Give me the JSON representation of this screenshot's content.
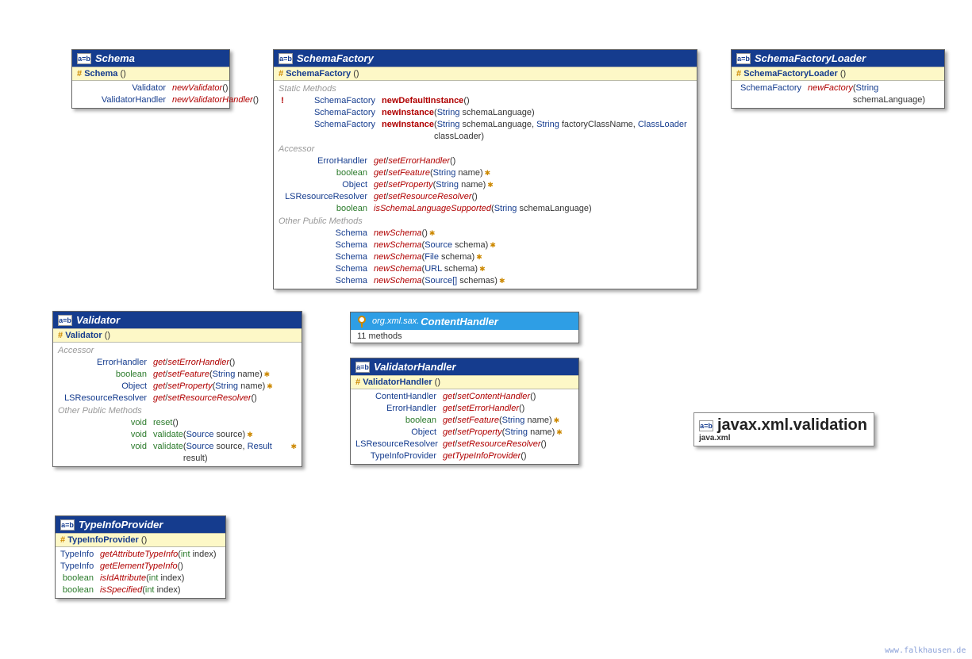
{
  "icons": {
    "ab_label": "a=b"
  },
  "package": {
    "name": "javax.xml.validation",
    "module": "java.xml"
  },
  "footer": "www.falkhausen.de",
  "classes": {
    "schema": {
      "title": "Schema",
      "constructor": "Schema",
      "methods": [
        {
          "ret": "Validator",
          "name": "newValidator",
          "params": "()"
        },
        {
          "ret": "ValidatorHandler",
          "name": "newValidatorHandler",
          "params": "()"
        }
      ]
    },
    "schemaFactory": {
      "title": "SchemaFactory",
      "constructor": "SchemaFactory",
      "sections": {
        "static": {
          "label": "Static Methods",
          "methods": [
            {
              "bang": true,
              "ret": "SchemaFactory",
              "name": "newDefaultInstance",
              "params": "()"
            },
            {
              "ret": "SchemaFactory",
              "name": "newInstance",
              "params_raw": [
                {
                  "t": "("
                },
                {
                  "t": "String ",
                  "c": "ptype"
                },
                {
                  "t": "schemaLanguage)"
                }
              ]
            },
            {
              "ret": "SchemaFactory",
              "name": "newInstance",
              "params_raw": [
                {
                  "t": "("
                },
                {
                  "t": "String ",
                  "c": "ptype"
                },
                {
                  "t": "schemaLanguage, "
                },
                {
                  "t": "String ",
                  "c": "ptype"
                },
                {
                  "t": "factoryClassName, "
                },
                {
                  "t": "ClassLoader ",
                  "c": "ptype"
                },
                {
                  "t": "classLoader)"
                }
              ]
            }
          ]
        },
        "accessor": {
          "label": "Accessor",
          "methods": [
            {
              "ret": "ErrorHandler",
              "getset": "ErrorHandler",
              "params": "()"
            },
            {
              "ret": "boolean",
              "prim": true,
              "getset": "Feature",
              "params_raw": [
                {
                  "t": "("
                },
                {
                  "t": "String ",
                  "c": "ptype"
                },
                {
                  "t": "name)"
                }
              ],
              "exc": true
            },
            {
              "ret": "Object",
              "getset": "Property",
              "params_raw": [
                {
                  "t": "("
                },
                {
                  "t": "String ",
                  "c": "ptype"
                },
                {
                  "t": "name)"
                }
              ],
              "exc": true
            },
            {
              "ret": "LSResourceResolver",
              "getset": "ResourceResolver",
              "params": "()"
            },
            {
              "ret": "boolean",
              "prim": true,
              "name": "isSchemaLanguageSupported",
              "params_raw": [
                {
                  "t": "("
                },
                {
                  "t": "String ",
                  "c": "ptype"
                },
                {
                  "t": "schemaLanguage)"
                }
              ]
            }
          ]
        },
        "other": {
          "label": "Other Public Methods",
          "methods": [
            {
              "ret": "Schema",
              "name": "newSchema",
              "params": "()",
              "exc": true
            },
            {
              "ret": "Schema",
              "name": "newSchema",
              "params_raw": [
                {
                  "t": "("
                },
                {
                  "t": "Source ",
                  "c": "ptype"
                },
                {
                  "t": "schema)"
                }
              ],
              "exc": true
            },
            {
              "ret": "Schema",
              "name": "newSchema",
              "params_raw": [
                {
                  "t": "("
                },
                {
                  "t": "File ",
                  "c": "ptype"
                },
                {
                  "t": "schema)"
                }
              ],
              "exc": true
            },
            {
              "ret": "Schema",
              "name": "newSchema",
              "params_raw": [
                {
                  "t": "("
                },
                {
                  "t": "URL ",
                  "c": "ptype"
                },
                {
                  "t": "schema)"
                }
              ],
              "exc": true
            },
            {
              "ret": "Schema",
              "name": "newSchema",
              "params_raw": [
                {
                  "t": "("
                },
                {
                  "t": "Source[] ",
                  "c": "ptype"
                },
                {
                  "t": "schemas)"
                }
              ],
              "exc": true
            }
          ]
        }
      }
    },
    "schemaFactoryLoader": {
      "title": "SchemaFactoryLoader",
      "constructor": "SchemaFactoryLoader",
      "methods": [
        {
          "ret": "SchemaFactory",
          "name": "newFactory",
          "params_raw": [
            {
              "t": "("
            },
            {
              "t": "String ",
              "c": "ptype"
            },
            {
              "t": "schemaLanguage)"
            }
          ]
        }
      ]
    },
    "validator": {
      "title": "Validator",
      "constructor": "Validator",
      "sections": {
        "accessor": {
          "label": "Accessor",
          "methods": [
            {
              "ret": "ErrorHandler",
              "getset": "ErrorHandler",
              "params": "()"
            },
            {
              "ret": "boolean",
              "prim": true,
              "getset": "Feature",
              "params_raw": [
                {
                  "t": "("
                },
                {
                  "t": "String ",
                  "c": "ptype"
                },
                {
                  "t": "name)"
                }
              ],
              "exc": true
            },
            {
              "ret": "Object",
              "getset": "Property",
              "params_raw": [
                {
                  "t": "("
                },
                {
                  "t": "String ",
                  "c": "ptype"
                },
                {
                  "t": "name)"
                }
              ],
              "exc": true
            },
            {
              "ret": "LSResourceResolver",
              "getset": "ResourceResolver",
              "params": "()"
            }
          ]
        },
        "other": {
          "label": "Other Public Methods",
          "methods": [
            {
              "ret": "void",
              "prim": true,
              "name_plain": "reset",
              "params": "()"
            },
            {
              "ret": "void",
              "prim": true,
              "name_plain": "validate",
              "params_raw": [
                {
                  "t": "("
                },
                {
                  "t": "Source ",
                  "c": "ptype"
                },
                {
                  "t": "source)"
                }
              ],
              "exc": true
            },
            {
              "ret": "void",
              "prim": true,
              "name_plain": "validate",
              "params_raw": [
                {
                  "t": "("
                },
                {
                  "t": "Source ",
                  "c": "ptype"
                },
                {
                  "t": "source, "
                },
                {
                  "t": "Result ",
                  "c": "ptype"
                },
                {
                  "t": "result)"
                }
              ],
              "exc": true
            }
          ]
        }
      }
    },
    "contentHandler": {
      "pkg": "org.xml.sax.",
      "title": "ContentHandler",
      "note": "11 methods"
    },
    "validatorHandler": {
      "title": "ValidatorHandler",
      "constructor": "ValidatorHandler",
      "methods": [
        {
          "ret": "ContentHandler",
          "getset": "ContentHandler",
          "params": "()"
        },
        {
          "ret": "ErrorHandler",
          "getset": "ErrorHandler",
          "params": "()"
        },
        {
          "ret": "boolean",
          "prim": true,
          "getset": "Feature",
          "params_raw": [
            {
              "t": "("
            },
            {
              "t": "String ",
              "c": "ptype"
            },
            {
              "t": "name)"
            }
          ],
          "exc": true
        },
        {
          "ret": "Object",
          "getset": "Property",
          "params_raw": [
            {
              "t": "("
            },
            {
              "t": "String ",
              "c": "ptype"
            },
            {
              "t": "name)"
            }
          ],
          "exc": true
        },
        {
          "ret": "LSResourceResolver",
          "getset": "ResourceResolver",
          "params": "()"
        },
        {
          "ret": "TypeInfoProvider",
          "name": "getTypeInfoProvider",
          "params": "()"
        }
      ]
    },
    "typeInfoProvider": {
      "title": "TypeInfoProvider",
      "constructor": "TypeInfoProvider",
      "methods": [
        {
          "ret": "TypeInfo",
          "name": "getAttributeTypeInfo",
          "params_raw": [
            {
              "t": "("
            },
            {
              "t": "int ",
              "c": "ptype prim"
            },
            {
              "t": "index)"
            }
          ]
        },
        {
          "ret": "TypeInfo",
          "name": "getElementTypeInfo",
          "params": "()"
        },
        {
          "ret": "boolean",
          "prim": true,
          "name": "isIdAttribute",
          "params_raw": [
            {
              "t": "("
            },
            {
              "t": "int ",
              "c": "ptype prim"
            },
            {
              "t": "index)"
            }
          ]
        },
        {
          "ret": "boolean",
          "prim": true,
          "name": "isSpecified",
          "params_raw": [
            {
              "t": "("
            },
            {
              "t": "int ",
              "c": "ptype prim"
            },
            {
              "t": "index)"
            }
          ]
        }
      ]
    }
  }
}
